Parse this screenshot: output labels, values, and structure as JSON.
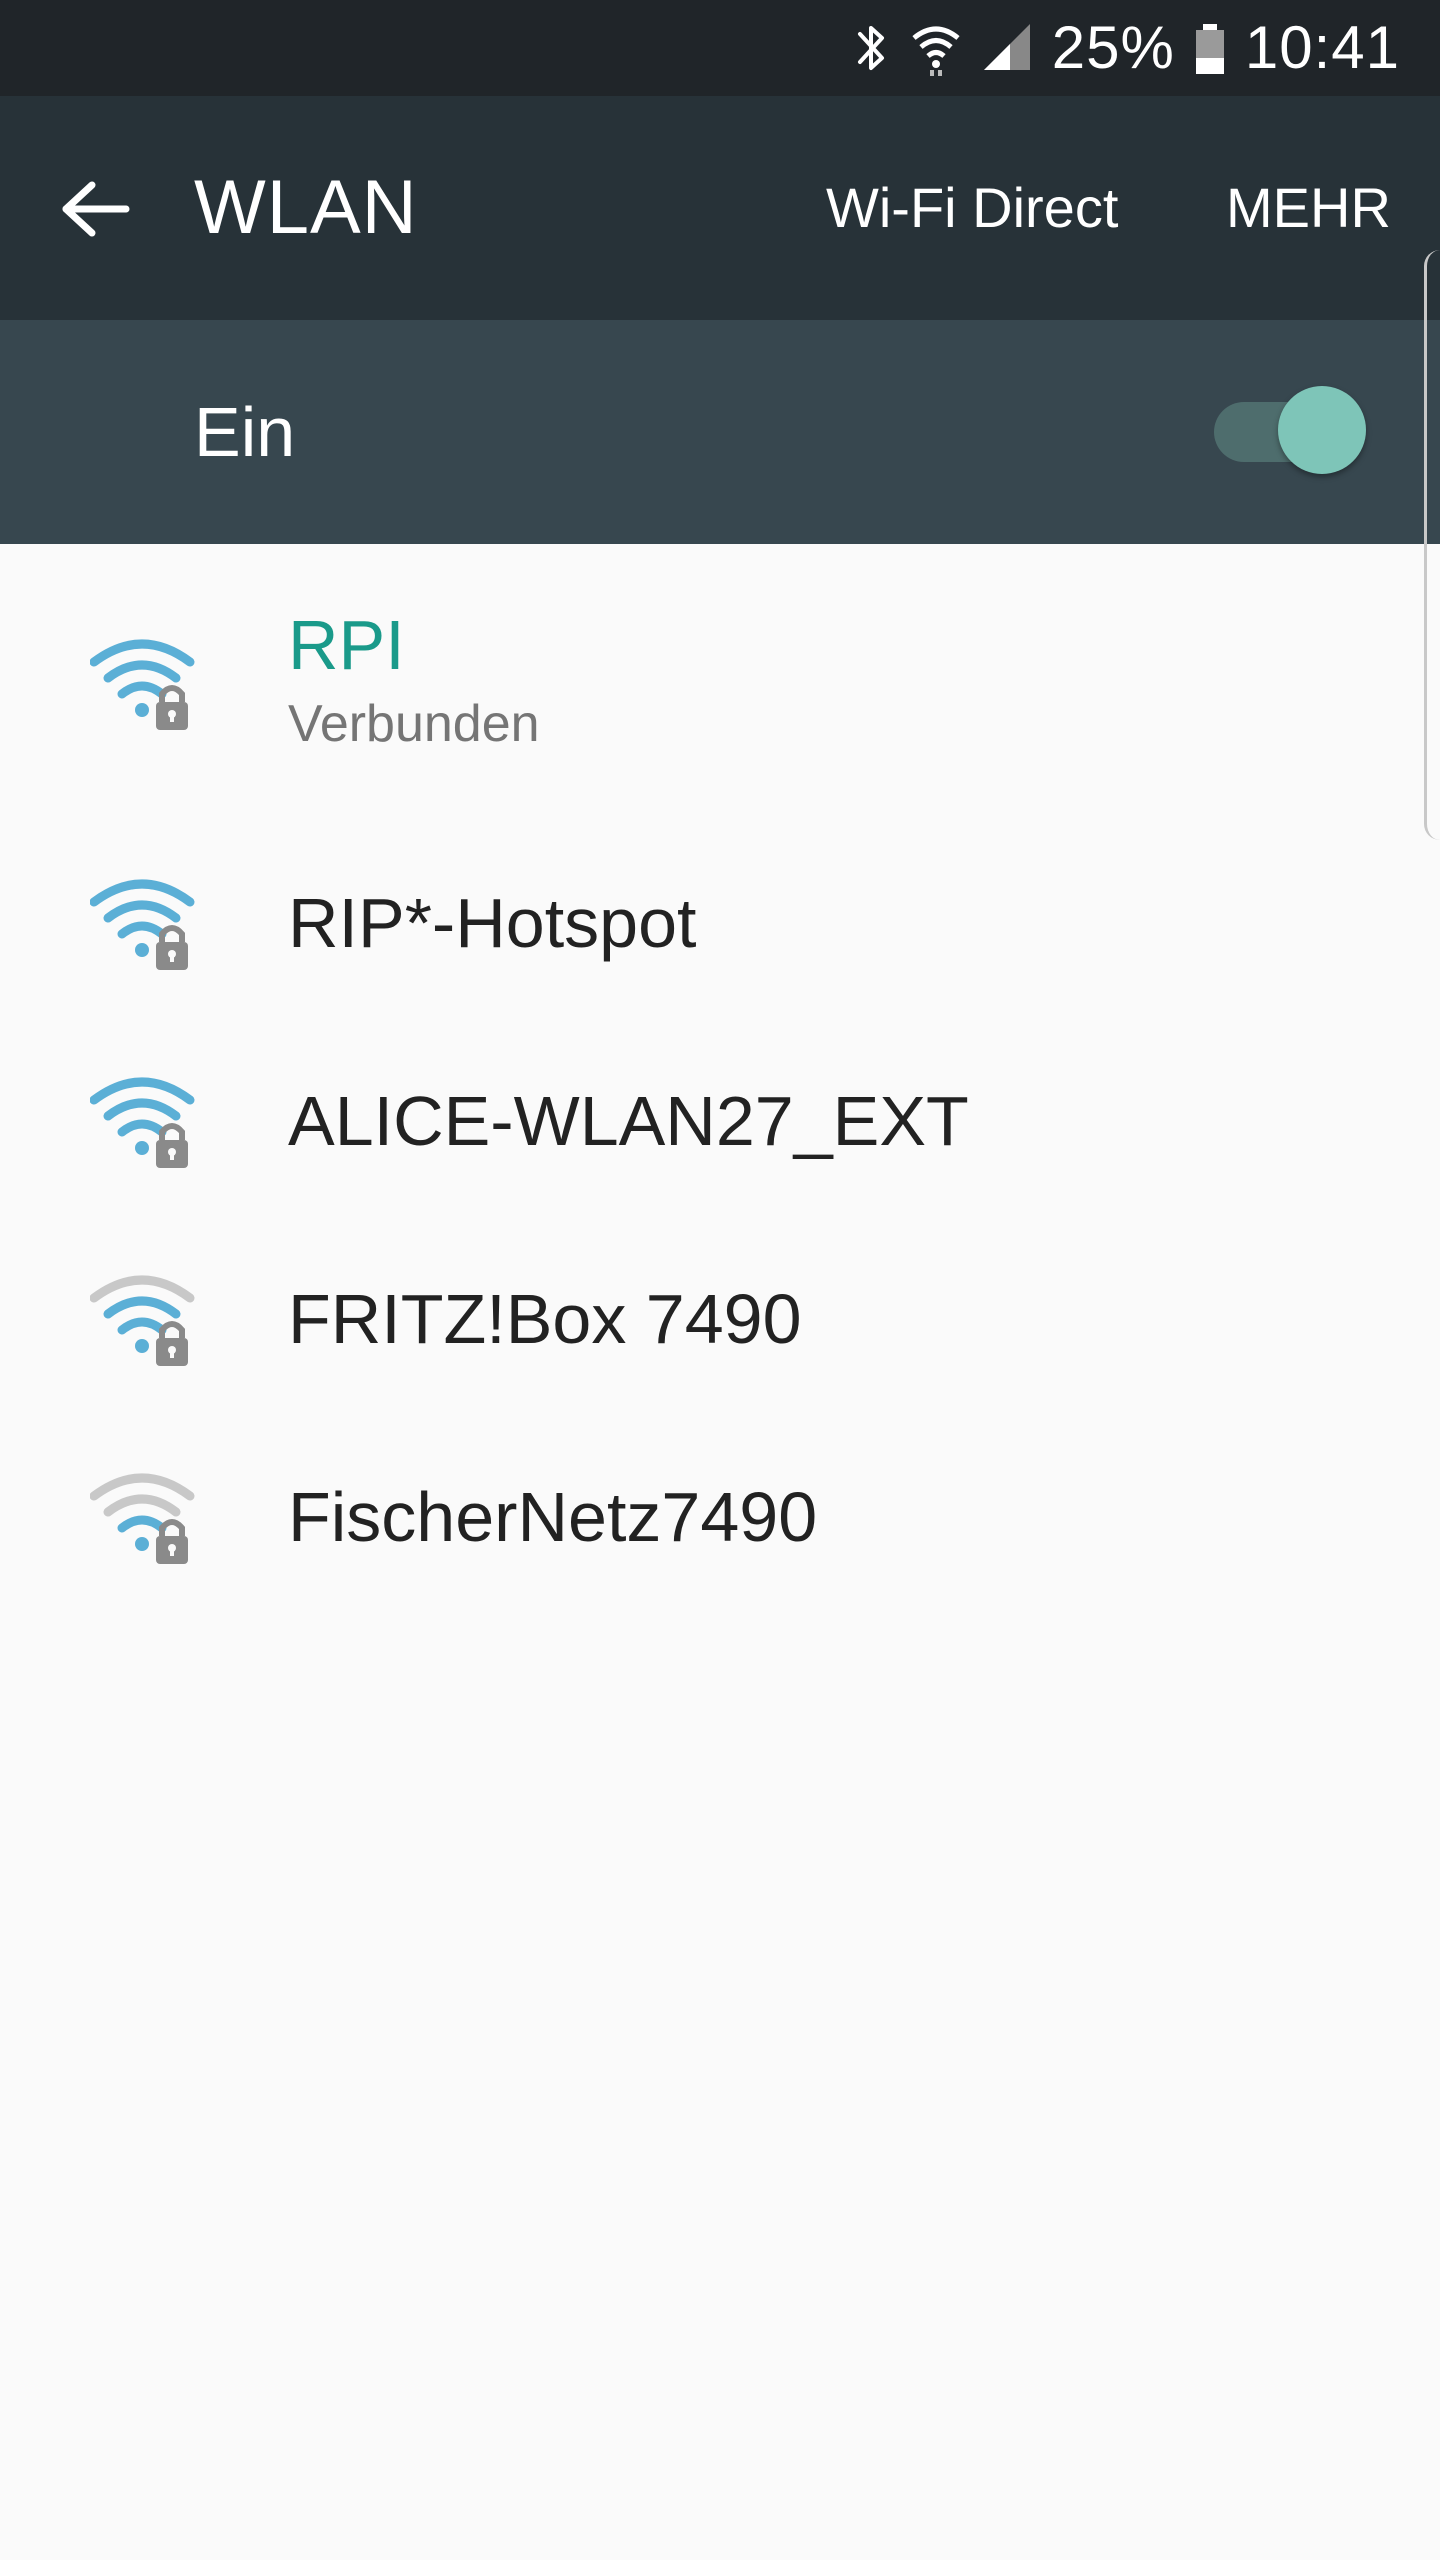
{
  "status_bar": {
    "battery_percent": "25%",
    "time": "10:41",
    "icons": [
      "bluetooth-icon",
      "wifi-status-icon",
      "cell-signal-icon",
      "battery-icon"
    ]
  },
  "app_bar": {
    "title": "WLAN",
    "back_icon": "arrow-back-icon",
    "wifi_direct_label": "Wi-Fi Direct",
    "more_label": "MEHR"
  },
  "master_switch": {
    "label": "Ein",
    "on": true
  },
  "networks": [
    {
      "name": "RPI",
      "status": "Verbunden",
      "connected": true,
      "signal": 3,
      "secured": true
    },
    {
      "name": "RIP*-Hotspot",
      "connected": false,
      "signal": 3,
      "secured": true
    },
    {
      "name": "ALICE-WLAN27_EXT",
      "connected": false,
      "signal": 3,
      "secured": true
    },
    {
      "name": "FRITZ!Box 7490",
      "connected": false,
      "signal": 2,
      "secured": true
    },
    {
      "name": "FischerNetz7490",
      "connected": false,
      "signal": 1,
      "secured": true
    }
  ],
  "colors": {
    "status_bar_bg": "#202529",
    "app_bar_bg": "#273238",
    "switch_row_bg": "#37474f",
    "accent": "#1a9a8a",
    "wifi_active": "#5bafd6",
    "wifi_inactive": "#c8c8c8",
    "lock": "#8a8a8a"
  }
}
